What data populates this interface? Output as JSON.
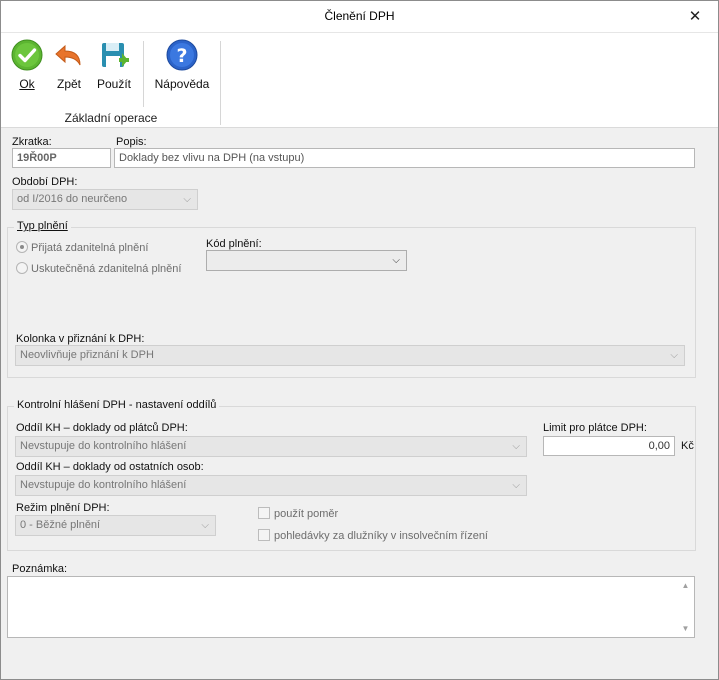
{
  "window": {
    "title": "Členění DPH",
    "close_glyph": "✕"
  },
  "toolbar": {
    "ok_label": "Ok",
    "back_label": "Zpět",
    "apply_label": "Použít",
    "help_label": "Nápověda",
    "group_label": "Základní operace",
    "icons": {
      "ok": "check-circle-icon",
      "back": "undo-arrow-icon",
      "apply": "save-disk-icon",
      "help": "help-question-icon"
    }
  },
  "form": {
    "zkratka": {
      "label": "Zkratka:",
      "value": "19Ř00P"
    },
    "popis": {
      "label": "Popis:",
      "value": "Doklady bez vlivu na DPH (na vstupu)"
    },
    "obdobi": {
      "label": "Období DPH:",
      "value": "od I/2016 do neurčeno"
    },
    "typ_plneni": {
      "title": "Typ plnění",
      "options": [
        "Přijatá zdanitelná plnění",
        "Uskutečněná zdanitelná plnění"
      ],
      "selected": "Přijatá zdanitelná plnění"
    },
    "kod_plneni": {
      "label": "Kód plnění:",
      "value": ""
    },
    "kolonka": {
      "label": "Kolonka v přiznání k DPH:",
      "value": "Neovlivňuje přiznání k DPH"
    },
    "kontrolni": {
      "title": "Kontrolní hlášení DPH - nastavení oddílů",
      "oddil_platcu": {
        "label": "Oddíl KH – doklady od plátců DPH:",
        "value": "Nevstupuje do kontrolního hlášení"
      },
      "oddil_ostatnich": {
        "label": "Oddíl KH – doklady od ostatních osob:",
        "value": "Nevstupuje do kontrolního hlášení"
      },
      "limit": {
        "label": "Limit pro plátce DPH:",
        "value": "0,00",
        "unit": "Kč"
      },
      "rezim": {
        "label": "Režim plnění DPH:",
        "value": "0 - Běžné plnění"
      },
      "pouzit_pomer": {
        "label": "použít poměr",
        "checked": false
      },
      "pohledavky": {
        "label": "pohledávky za dlužníky v insolvečním řízení",
        "checked": false
      }
    },
    "poznamka": {
      "label": "Poznámka:",
      "value": ""
    }
  },
  "colors": {
    "ok_green": "#5cb531",
    "back_orange": "#e8742c",
    "help_blue": "#2b63c9",
    "disk_teal": "#2a8fb0"
  }
}
